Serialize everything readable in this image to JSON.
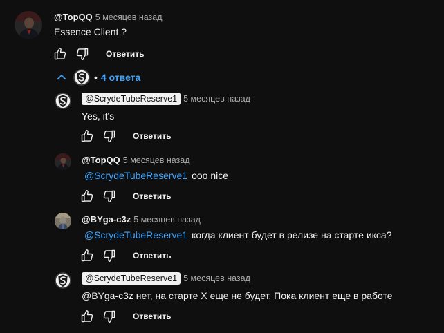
{
  "colors": {
    "background": "#0f0f0f",
    "text": "#f1f1f1",
    "muted": "#aaaaaa",
    "link": "#3ea6ff"
  },
  "comment": {
    "author": "@TopQQ",
    "time": "5 месяцев назад",
    "text": "Essence Client ?",
    "reply_label": "Ответить"
  },
  "replies_toggle": {
    "label": "4 ответа",
    "bullet": "•"
  },
  "replies": [
    {
      "author": "@ScrydeTubeReserve1",
      "time": "5 месяцев назад",
      "mention": "",
      "text": "Yes, it's",
      "reply_label": "Ответить"
    },
    {
      "author": "@TopQQ",
      "time": "5 месяцев назад",
      "mention": "@ScrydeTubeReserve1",
      "text": "ooo nice",
      "reply_label": "Ответить"
    },
    {
      "author": "@BYga-c3z",
      "time": "5 месяцев назад",
      "mention": "@ScrydeTubeReserve1",
      "text": "когда клиент будет в релизе на старте икса?",
      "reply_label": "Ответить"
    },
    {
      "author": "@ScrydeTubeReserve1",
      "time": "5 месяцев назад",
      "mention": "",
      "text": "@BYga-c3z нет, на старте X еще не будет. Пока клиент еще в работе",
      "reply_label": "Ответить"
    }
  ]
}
